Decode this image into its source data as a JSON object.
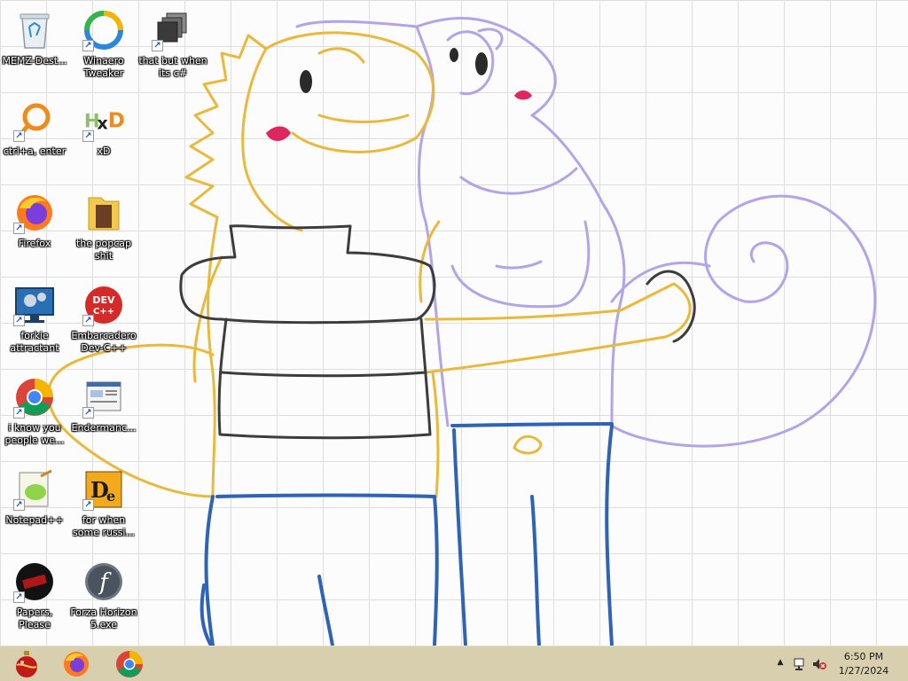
{
  "desktop": {
    "icons": [
      {
        "label": "MEMZ-Dest...",
        "icon": "recycle-bin-icon"
      },
      {
        "label": "Winaero Tweaker",
        "icon": "winaero-tweaker-icon"
      },
      {
        "label": "that but when its c#",
        "icon": "stacked-windows-icon"
      },
      {
        "label": "ctrl+a, enter",
        "icon": "magnifier-ring-icon"
      },
      {
        "label": "xD",
        "icon": "hxd-icon"
      },
      {
        "label": "Firefox",
        "icon": "firefox-icon"
      },
      {
        "label": "the popcap shit",
        "icon": "folder-icon"
      },
      {
        "label": "forkie attractant",
        "icon": "monitor-gears-icon"
      },
      {
        "label": "Embarcadero Dev-C++",
        "icon": "devcpp-icon"
      },
      {
        "label": "i know you people we...",
        "icon": "chrome-icon"
      },
      {
        "label": "Endermanc...",
        "icon": "web-page-icon"
      },
      {
        "label": "Notepad++",
        "icon": "notepadpp-icon"
      },
      {
        "label": "for when some russi...",
        "icon": "de-icon"
      },
      {
        "label": "Papers, Please",
        "icon": "papers-please-icon"
      },
      {
        "label": "Forza Horizon 5.exe",
        "icon": "flash-icon"
      }
    ],
    "wallpaper_colors": {
      "yellow": "#e8b93a",
      "purple": "#b3a4e8",
      "blue": "#2f63b5",
      "black": "#3c3c3c",
      "pink": "#e0265f"
    }
  },
  "taskbar": {
    "pinned": [
      {
        "name": "ornament-app",
        "icon": "christmas-ornament-icon"
      },
      {
        "name": "firefox",
        "icon": "firefox-icon"
      },
      {
        "name": "chrome",
        "icon": "chrome-icon"
      }
    ],
    "tray": {
      "show_hidden": "▲",
      "network_icon": "network-icon",
      "volume_icon": "volume-muted-icon"
    },
    "clock": {
      "time": "6:50 PM",
      "date": "1/27/2024"
    },
    "color": "#d7cfae"
  }
}
